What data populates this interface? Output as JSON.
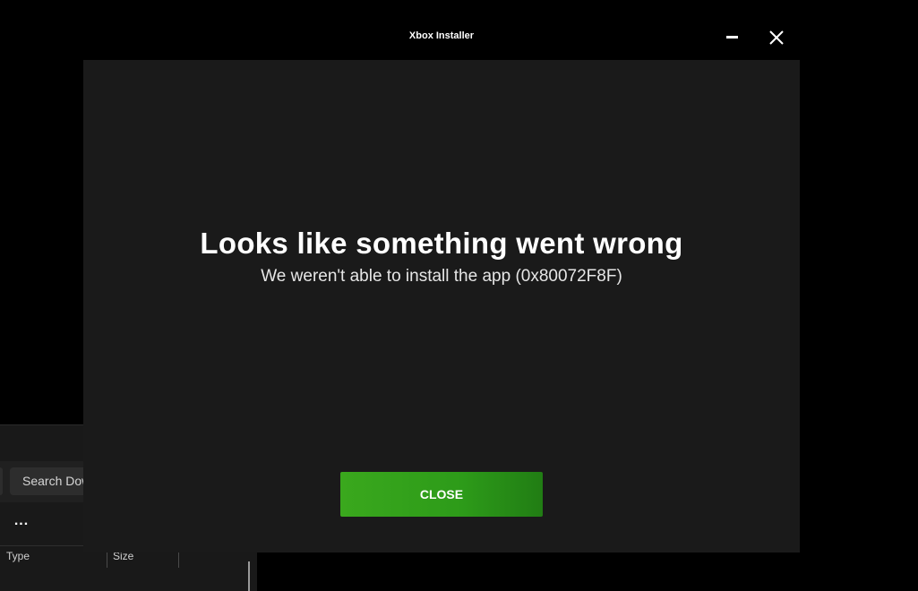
{
  "background_window": {
    "search_placeholder": "Search Dow",
    "more_label": "...",
    "columns": [
      "Type",
      "Size"
    ]
  },
  "installer": {
    "title": "Xbox Installer",
    "minimize_icon": "minimize-icon",
    "close_icon": "close-icon",
    "error_headline": "Looks like something went wrong",
    "error_detail": "We weren't able to install the app (0x80072F8F)",
    "close_button_label": "CLOSE",
    "accent_color": "#33a11b"
  }
}
